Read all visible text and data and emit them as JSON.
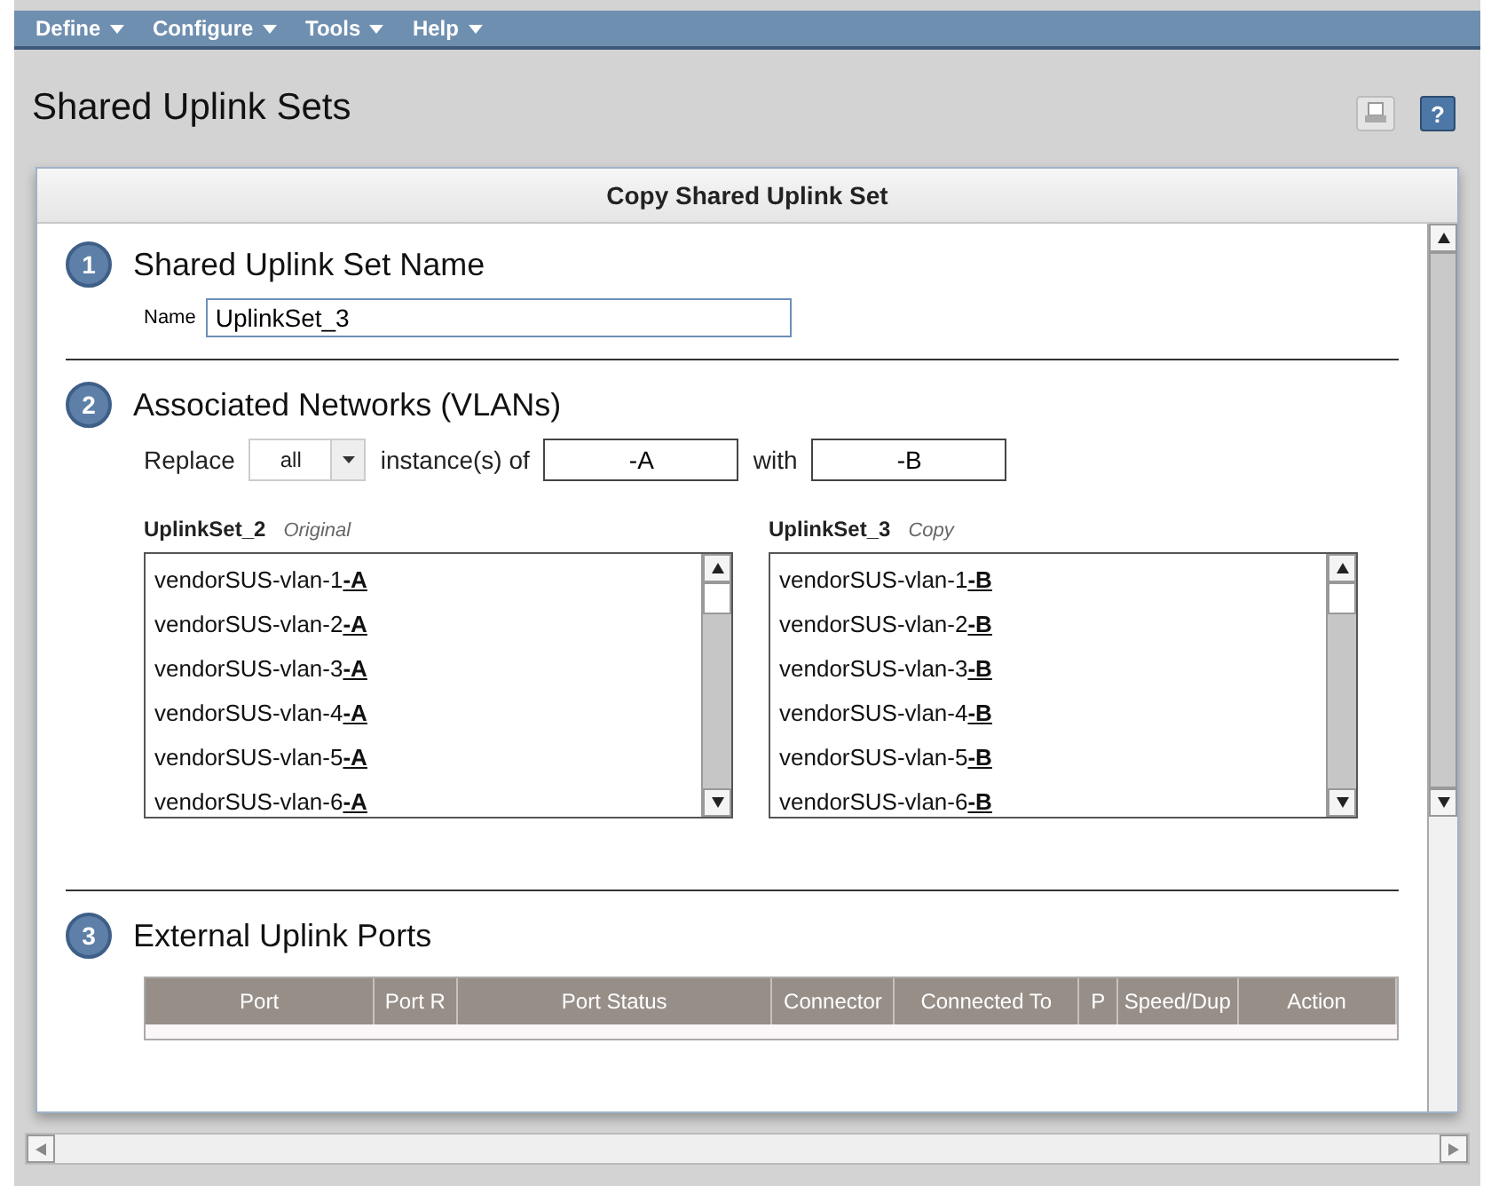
{
  "menu": [
    {
      "label": "Define"
    },
    {
      "label": "Configure"
    },
    {
      "label": "Tools"
    },
    {
      "label": "Help"
    }
  ],
  "page_title": "Shared Uplink Sets",
  "help_button": "?",
  "dialog": {
    "title": "Copy Shared Uplink Set",
    "sections": [
      {
        "number": "1",
        "title": "Shared Uplink Set Name",
        "kind": "name",
        "name_label": "Name",
        "name_value": "UplinkSet_3"
      },
      {
        "number": "2",
        "title": "Associated Networks (VLANs)",
        "kind": "networks",
        "replace_label": "Replace",
        "replace_option": "all",
        "instances_label": "instance(s) of",
        "find_value": "-A",
        "with_label": "with",
        "replace_value": "-B",
        "lists": [
          {
            "name": "UplinkSet_2",
            "note": "Original",
            "items": [
              {
                "name": "vendorSUS-vlan-1",
                "suffix": "-A"
              },
              {
                "name": "vendorSUS-vlan-2",
                "suffix": "-A"
              },
              {
                "name": "vendorSUS-vlan-3",
                "suffix": "-A"
              },
              {
                "name": "vendorSUS-vlan-4",
                "suffix": "-A"
              },
              {
                "name": "vendorSUS-vlan-5",
                "suffix": "-A"
              },
              {
                "name": "vendorSUS-vlan-6",
                "suffix": "-A"
              }
            ]
          },
          {
            "name": "UplinkSet_3",
            "note": "Copy",
            "items": [
              {
                "name": "vendorSUS-vlan-1",
                "suffix": "-B"
              },
              {
                "name": "vendorSUS-vlan-2",
                "suffix": "-B"
              },
              {
                "name": "vendorSUS-vlan-3",
                "suffix": "-B"
              },
              {
                "name": "vendorSUS-vlan-4",
                "suffix": "-B"
              },
              {
                "name": "vendorSUS-vlan-5",
                "suffix": "-B"
              },
              {
                "name": "vendorSUS-vlan-6",
                "suffix": "-B"
              }
            ]
          }
        ]
      },
      {
        "number": "3",
        "title": "External Uplink Ports",
        "kind": "ports",
        "columns": [
          "Port",
          "Port R",
          "Port Status",
          "Connector",
          "Connected To",
          "P",
          "Speed/Dup",
          "Action"
        ]
      }
    ]
  }
}
